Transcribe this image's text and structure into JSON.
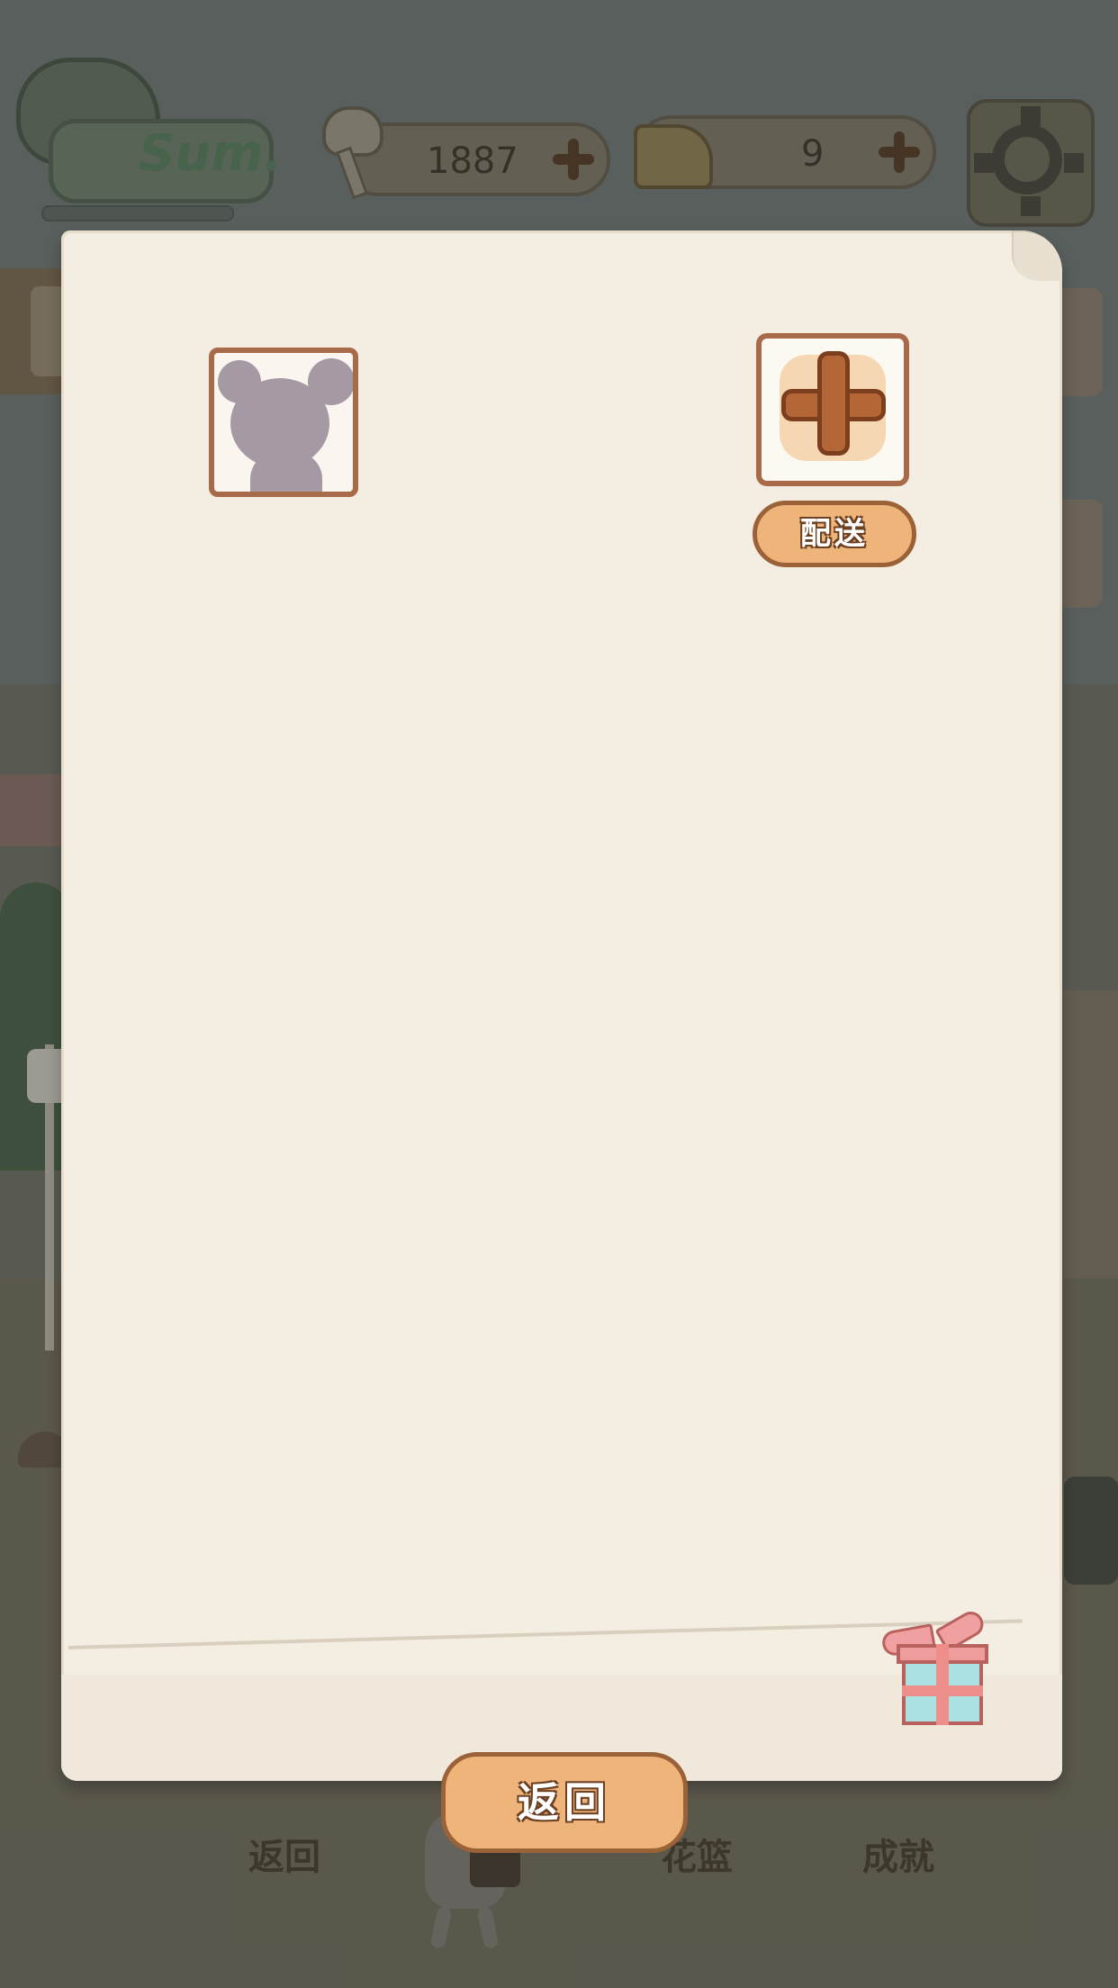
{
  "hud": {
    "logo_text": "Sum.",
    "fish_bones": "1887",
    "cheese": "9"
  },
  "icons": {
    "settings": "gear-icon",
    "fish": "fish-bone-icon",
    "cheese": "cheese-icon",
    "add": "plus-icon",
    "gift": "gift-icon",
    "avatar_placeholder": "character-silhouette-icon"
  },
  "panel": {
    "deliver_label": "配送",
    "return_label": "返回"
  },
  "bottom_nav": {
    "return_label": "返回",
    "basket_label": "花篮",
    "achievements_label": "成就"
  },
  "colors": {
    "paper": "#f3ede2",
    "button_fill": "#efb47a",
    "button_border": "#9b6237",
    "slot_border": "#a86a49",
    "plus": "#b56636"
  }
}
